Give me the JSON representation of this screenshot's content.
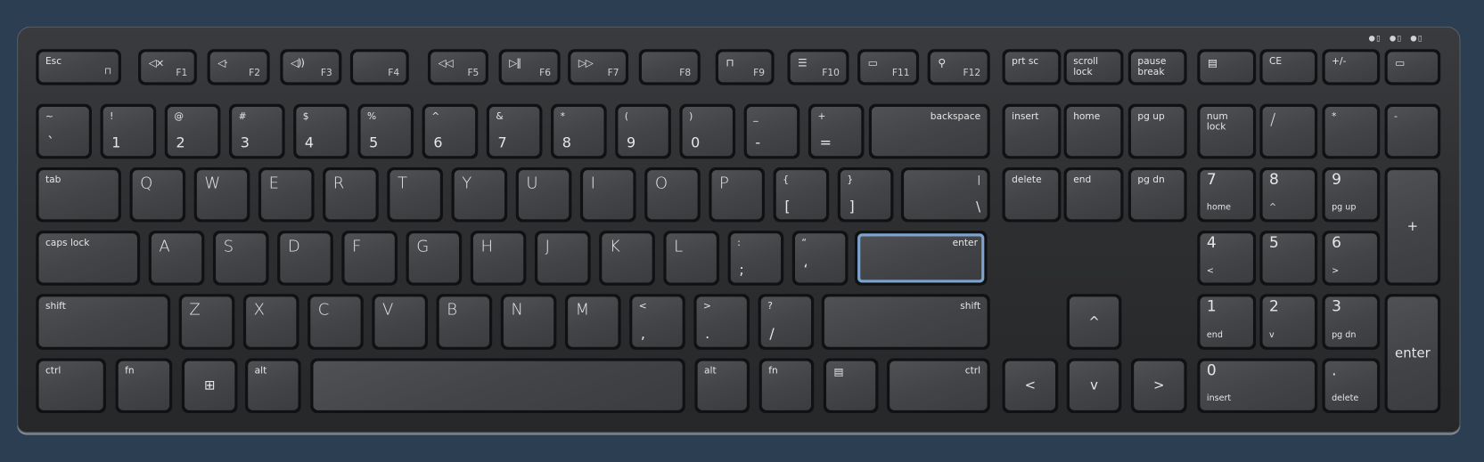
{
  "title": "Keyboard",
  "indicators": [
    "caps-lock-led",
    "num-lock-led",
    "scroll-lock-led"
  ],
  "highlight_color": "#7da4cf",
  "keys": [
    {
      "id": "esc",
      "t": "Esc",
      "ic": "lock-icon"
    },
    {
      "id": "f1",
      "fn": "F1",
      "ic": "mute-icon"
    },
    {
      "id": "f2",
      "fn": "F2",
      "ic": "volume-down-icon"
    },
    {
      "id": "f3",
      "fn": "F3",
      "ic": "volume-up-icon"
    },
    {
      "id": "f4",
      "fn": "F4"
    },
    {
      "id": "f5",
      "fn": "F5",
      "ic": "rewind-icon"
    },
    {
      "id": "f6",
      "fn": "F6",
      "ic": "play-pause-icon"
    },
    {
      "id": "f7",
      "fn": "F7",
      "ic": "fast-forward-icon"
    },
    {
      "id": "f8",
      "fn": "F8"
    },
    {
      "id": "f9",
      "fn": "F9",
      "ic": "lock-icon"
    },
    {
      "id": "f10",
      "fn": "F10",
      "ic": "display-icon"
    },
    {
      "id": "f11",
      "fn": "F11",
      "ic": "screenshot-icon"
    },
    {
      "id": "f12",
      "fn": "F12",
      "ic": "search-icon"
    },
    {
      "id": "prtsc",
      "t": "prt sc"
    },
    {
      "id": "scroll-lock",
      "t": "scroll\nlock"
    },
    {
      "id": "pause",
      "t": "pause\nbreak"
    },
    {
      "id": "calculator",
      "ic": "calculator-icon"
    },
    {
      "id": "ce",
      "t": "CE"
    },
    {
      "id": "plus-minus",
      "t": "+/-"
    },
    {
      "id": "comment",
      "ic": "comment-icon"
    },
    {
      "id": "tilde",
      "t": "~",
      "sl": "`"
    },
    {
      "id": "1",
      "t": "!",
      "sl": "1"
    },
    {
      "id": "2",
      "t": "@",
      "sl": "2"
    },
    {
      "id": "3",
      "t": "#",
      "sl": "3"
    },
    {
      "id": "4",
      "t": "$",
      "sl": "4"
    },
    {
      "id": "5",
      "t": "%",
      "sl": "5"
    },
    {
      "id": "6",
      "t": "^",
      "sl": "6"
    },
    {
      "id": "7",
      "t": "&",
      "sl": "7"
    },
    {
      "id": "8",
      "t": "*",
      "sl": "8"
    },
    {
      "id": "9",
      "t": "(",
      "sl": "9"
    },
    {
      "id": "0",
      "t": ")",
      "sl": "0"
    },
    {
      "id": "minus",
      "t": "_",
      "sl": "-"
    },
    {
      "id": "equals",
      "t": "+",
      "sl": "="
    },
    {
      "id": "backspace",
      "r": "backspace"
    },
    {
      "id": "insert",
      "t": "insert"
    },
    {
      "id": "home",
      "t": "home"
    },
    {
      "id": "pgup",
      "t": "pg up"
    },
    {
      "id": "numlock",
      "t": "num\nlock"
    },
    {
      "id": "num-divide",
      "m": "/"
    },
    {
      "id": "num-multiply",
      "t": "*"
    },
    {
      "id": "num-minus",
      "t": "-"
    },
    {
      "id": "tab",
      "t": "tab"
    },
    {
      "id": "q",
      "m": "Q"
    },
    {
      "id": "w",
      "m": "W"
    },
    {
      "id": "e",
      "m": "E"
    },
    {
      "id": "r",
      "m": "R"
    },
    {
      "id": "t",
      "m": "T"
    },
    {
      "id": "y",
      "m": "Y"
    },
    {
      "id": "u",
      "m": "U"
    },
    {
      "id": "i",
      "m": "I"
    },
    {
      "id": "o",
      "m": "O"
    },
    {
      "id": "p",
      "m": "P"
    },
    {
      "id": "lbracket",
      "t": "{",
      "sl": "["
    },
    {
      "id": "rbracket",
      "t": "}",
      "sl": "]"
    },
    {
      "id": "backslash",
      "r": "|",
      "sr": "\\"
    },
    {
      "id": "delete",
      "t": "delete"
    },
    {
      "id": "end",
      "t": "end"
    },
    {
      "id": "pgdn",
      "t": "pg dn"
    },
    {
      "id": "num7",
      "nm": "7",
      "sub": "home"
    },
    {
      "id": "num8",
      "nm": "8",
      "sub": "^"
    },
    {
      "id": "num9",
      "nm": "9",
      "sub": "pg up"
    },
    {
      "id": "num-plus",
      "cm": "+"
    },
    {
      "id": "caps-lock",
      "t": "caps lock"
    },
    {
      "id": "a",
      "m": "A"
    },
    {
      "id": "s",
      "m": "S"
    },
    {
      "id": "d",
      "m": "D"
    },
    {
      "id": "f",
      "m": "F"
    },
    {
      "id": "g",
      "m": "G"
    },
    {
      "id": "h",
      "m": "H"
    },
    {
      "id": "j",
      "m": "J"
    },
    {
      "id": "k",
      "m": "K"
    },
    {
      "id": "l",
      "m": "L"
    },
    {
      "id": "semicolon",
      "t": ":",
      "sl": ";"
    },
    {
      "id": "quote",
      "t": "“",
      "sl": "‘"
    },
    {
      "id": "enter",
      "r": "enter",
      "hl": true
    },
    {
      "id": "num4",
      "nm": "4",
      "sub": "<"
    },
    {
      "id": "num5",
      "nm": "5"
    },
    {
      "id": "num6",
      "nm": "6",
      "sub": ">"
    },
    {
      "id": "left-shift",
      "t": "shift"
    },
    {
      "id": "z",
      "m": "Z"
    },
    {
      "id": "x",
      "m": "X"
    },
    {
      "id": "c",
      "m": "C"
    },
    {
      "id": "v",
      "m": "V"
    },
    {
      "id": "b",
      "m": "B"
    },
    {
      "id": "n",
      "m": "N"
    },
    {
      "id": "m",
      "m": "M"
    },
    {
      "id": "comma",
      "t": "<",
      "sl": ","
    },
    {
      "id": "period",
      "t": ">",
      "sl": "."
    },
    {
      "id": "slash",
      "t": "?",
      "sl": "/"
    },
    {
      "id": "right-shift",
      "r": "shift"
    },
    {
      "id": "arrow-up",
      "cm": "^"
    },
    {
      "id": "num1",
      "nm": "1",
      "sub": "end"
    },
    {
      "id": "num2",
      "nm": "2",
      "sub": "v"
    },
    {
      "id": "num3",
      "nm": "3",
      "sub": "pg dn"
    },
    {
      "id": "num-enter",
      "cm": "enter"
    },
    {
      "id": "left-ctrl",
      "t": "ctrl"
    },
    {
      "id": "left-fn",
      "t": "fn"
    },
    {
      "id": "windows",
      "ic": "windows-icon",
      "center": true
    },
    {
      "id": "left-alt",
      "t": "alt"
    },
    {
      "id": "space"
    },
    {
      "id": "right-alt",
      "t": "alt"
    },
    {
      "id": "right-fn",
      "t": "fn"
    },
    {
      "id": "menu",
      "ic": "menu-icon"
    },
    {
      "id": "right-ctrl",
      "r": "ctrl"
    },
    {
      "id": "arrow-left",
      "cm": "<"
    },
    {
      "id": "arrow-down",
      "cm": "v"
    },
    {
      "id": "arrow-right",
      "cm": ">"
    },
    {
      "id": "num0",
      "nm": "0",
      "sub": "insert"
    },
    {
      "id": "num-decimal",
      "nm": ".",
      "sub": "delete"
    }
  ]
}
